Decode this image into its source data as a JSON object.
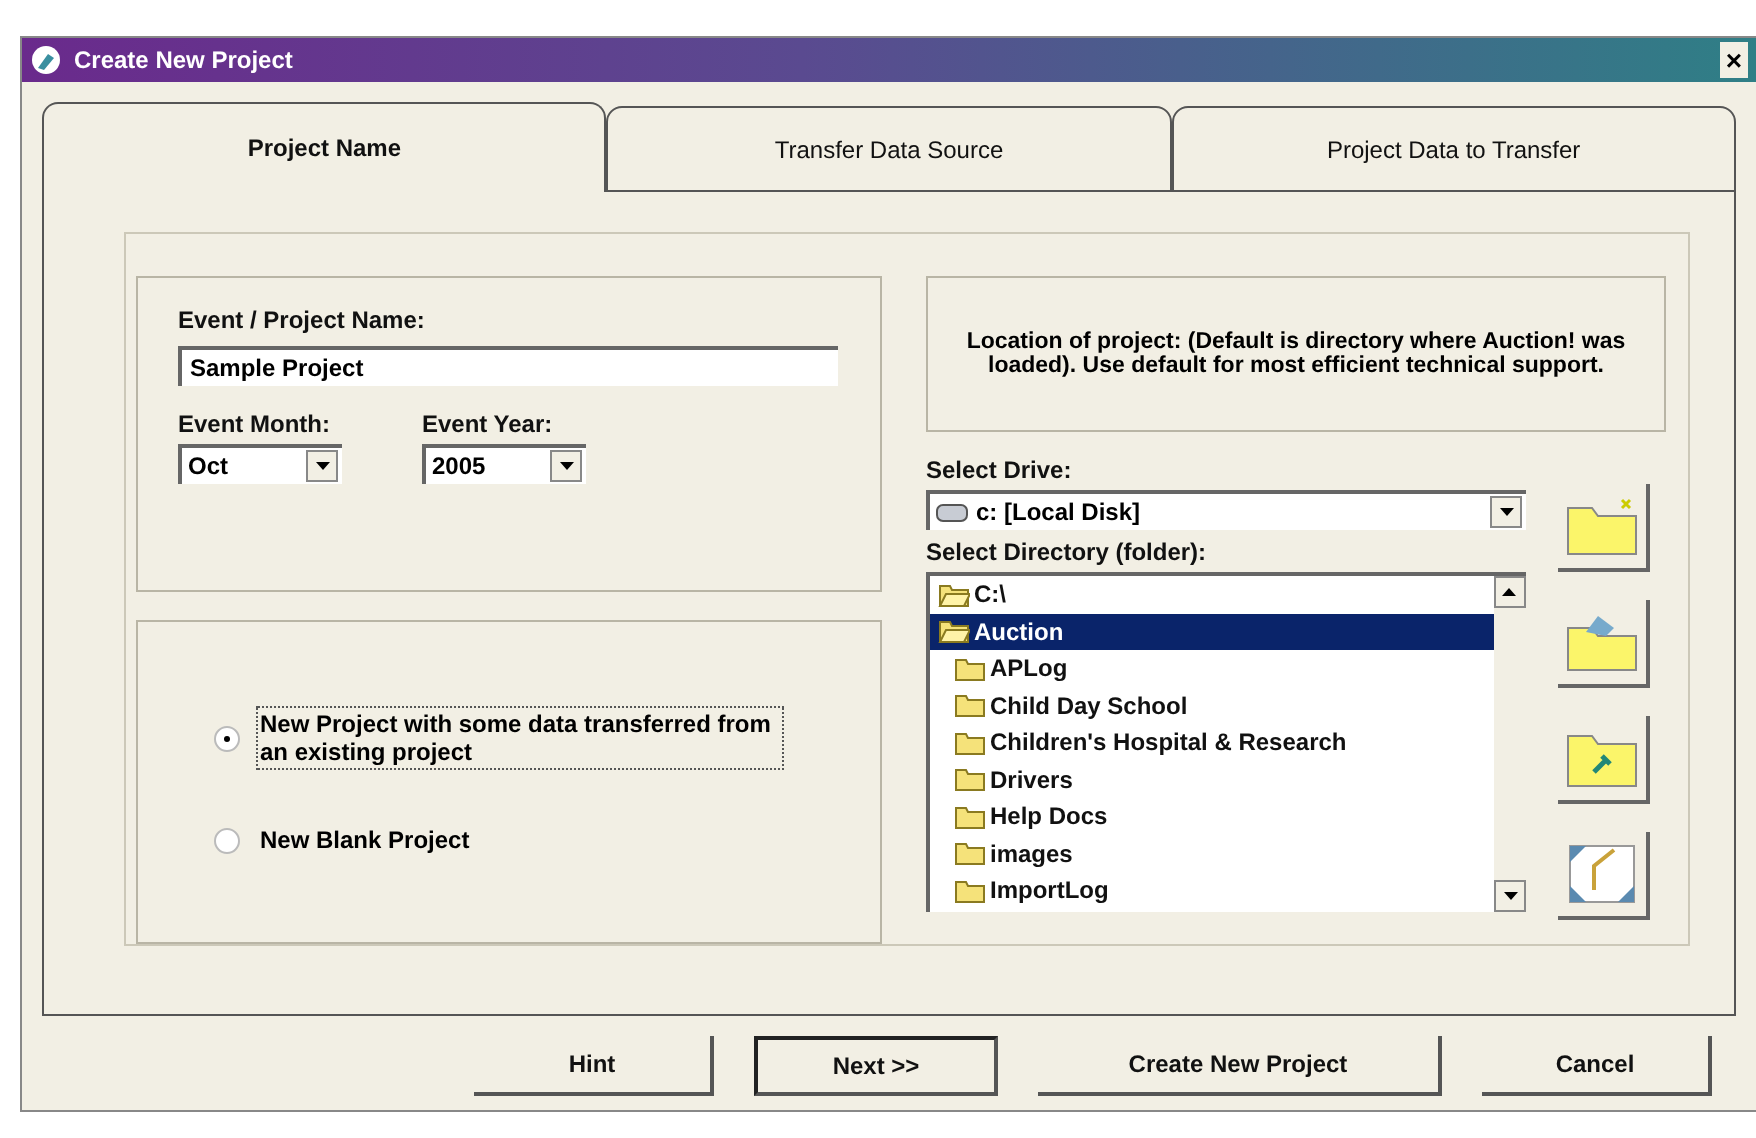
{
  "window": {
    "title": "Create New Project",
    "close": "×"
  },
  "tabs": [
    {
      "label": "Project Name",
      "selected": true
    },
    {
      "label": "Transfer Data Source",
      "selected": false
    },
    {
      "label": "Project Data to Transfer",
      "selected": false
    }
  ],
  "event": {
    "name_label": "Event / Project Name:",
    "name_value": "Sample Project",
    "month_label": "Event Month:",
    "month_value": "Oct",
    "year_label": "Event Year:",
    "year_value": "2005"
  },
  "project_type": [
    {
      "label": "New Project with some data transferred from an existing project",
      "selected": true
    },
    {
      "label": "New Blank Project",
      "selected": false
    }
  ],
  "location_note": "Location of project:  (Default is directory where Auction! was loaded).  Use default for most efficient technical support.",
  "drive": {
    "label": "Select Drive:",
    "value": "c: [Local Disk]"
  },
  "directory": {
    "label": "Select Directory (folder):",
    "tree": [
      {
        "name": "C:\\",
        "kind": "open",
        "selected": false,
        "children": [
          {
            "name": "Auction",
            "kind": "open",
            "selected": true,
            "children": [
              {
                "name": "APLog",
                "kind": "closed",
                "selected": false
              },
              {
                "name": "Child Day School",
                "kind": "closed",
                "selected": false
              },
              {
                "name": "Children's Hospital & Research",
                "kind": "closed",
                "selected": false
              },
              {
                "name": "Drivers",
                "kind": "closed",
                "selected": false
              },
              {
                "name": "Help Docs",
                "kind": "closed",
                "selected": false
              },
              {
                "name": "images",
                "kind": "closed",
                "selected": false
              },
              {
                "name": "ImportLog",
                "kind": "closed",
                "selected": false
              }
            ]
          }
        ]
      }
    ]
  },
  "buttons": [
    {
      "label": "Hint",
      "default": false
    },
    {
      "label": "Next >>",
      "default": true
    },
    {
      "label": "Create New Project",
      "default": false
    },
    {
      "label": "Cancel",
      "default": false
    }
  ]
}
